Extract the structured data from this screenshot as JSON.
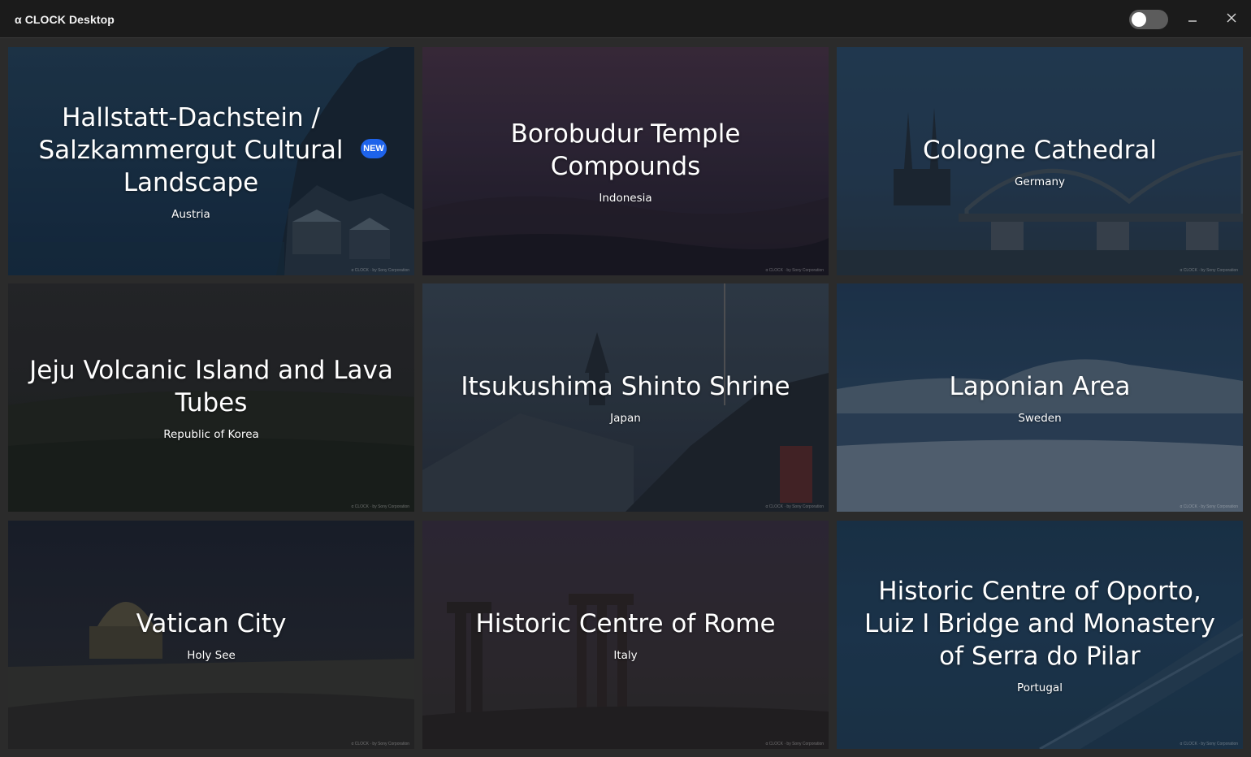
{
  "window": {
    "title": "α CLOCK Desktop",
    "toggle_state": "off",
    "minimize_icon": "minimize-icon",
    "close_icon": "close-icon"
  },
  "cards": [
    {
      "name": "Hallstatt-Dachstein / Salzkammergut Cultural Landscape",
      "country": "Austria",
      "badge": "NEW",
      "watermark": "α CLOCK · by Sony Corporation"
    },
    {
      "name": "Borobudur Temple Compounds",
      "country": "Indonesia",
      "watermark": "α CLOCK · by Sony Corporation"
    },
    {
      "name": "Cologne Cathedral",
      "country": "Germany",
      "watermark": "α CLOCK · by Sony Corporation"
    },
    {
      "name": "Jeju Volcanic Island and Lava Tubes",
      "country": "Republic of Korea",
      "watermark": "α CLOCK · by Sony Corporation"
    },
    {
      "name": "Itsukushima Shinto Shrine",
      "country": "Japan",
      "watermark": "α CLOCK · by Sony Corporation"
    },
    {
      "name": "Laponian Area",
      "country": "Sweden",
      "watermark": "α CLOCK · by Sony Corporation"
    },
    {
      "name": "Vatican City",
      "country": "Holy See",
      "watermark": "α CLOCK · by Sony Corporation"
    },
    {
      "name": "Historic Centre of Rome",
      "country": "Italy",
      "watermark": "α CLOCK · by Sony Corporation"
    },
    {
      "name": "Historic Centre of Oporto, Luiz I Bridge and Monastery of Serra do Pilar",
      "country": "Portugal",
      "watermark": "α CLOCK · by Sony Corporation"
    }
  ],
  "colors": {
    "titlebar_bg": "#1b1b1b",
    "window_bg": "#2b2b2b",
    "badge_new": "#1e63ea"
  }
}
